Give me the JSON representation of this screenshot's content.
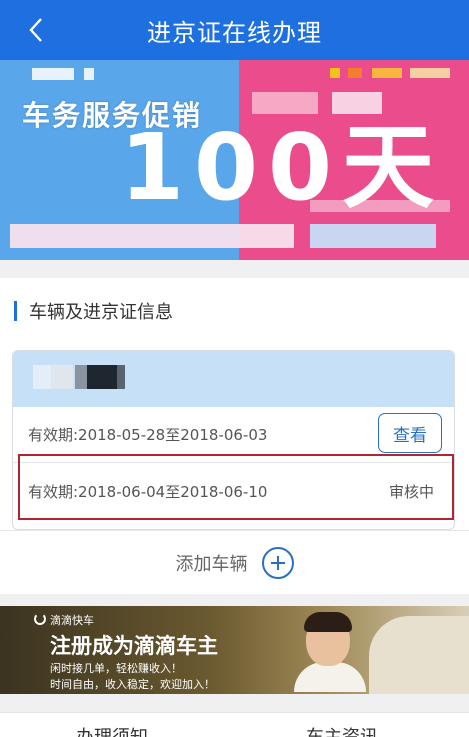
{
  "header": {
    "title": "进京证在线办理"
  },
  "banner": {
    "promo_text": "车务服务促销",
    "big_text": "100天"
  },
  "vehicle_section": {
    "title": "车辆及进京证信息",
    "permits": [
      {
        "validity": "有效期:2018-05-28至2018-06-03",
        "action_label": "查看"
      },
      {
        "validity": "有效期:2018-06-04至2018-06-10",
        "status": "审核中"
      }
    ],
    "add_vehicle_label": "添加车辆"
  },
  "ad": {
    "brand": "滴滴快车",
    "headline": "注册成为滴滴车主",
    "line1": "闲时接几单，轻松赚收入！",
    "line2": "时间自由，收入稳定，欢迎加入！"
  },
  "bottom_tabs": [
    {
      "label": "办理须知"
    },
    {
      "label": "车主资讯"
    }
  ],
  "colors": {
    "header": "#1e6fe0",
    "accent": "#2b6fc4",
    "highlight": "#b02530"
  }
}
